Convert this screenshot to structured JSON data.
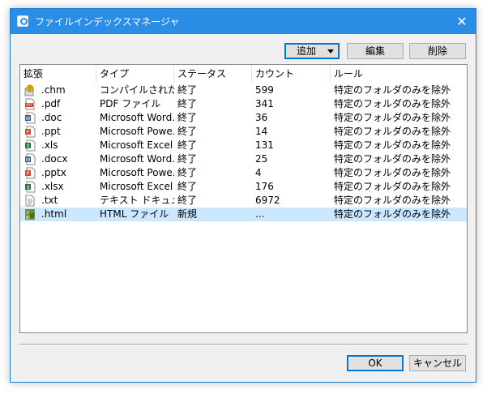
{
  "window": {
    "title": "ファイルインデックスマネージャ",
    "close_glyph": "✕"
  },
  "toolbar": {
    "add_label": "追加",
    "edit_label": "編集",
    "delete_label": "削除"
  },
  "columns": [
    "拡張",
    "タイプ",
    "ステータス",
    "カウント",
    "ルール"
  ],
  "rows": [
    {
      "ext": ".chm",
      "type": "コンパイルされた H...",
      "status": "終了",
      "count": "599",
      "rule": "特定のフォルダのみを除外",
      "icon": "chm-help-icon"
    },
    {
      "ext": ".pdf",
      "type": "PDF ファイル",
      "status": "終了",
      "count": "341",
      "rule": "特定のフォルダのみを除外",
      "icon": "pdf-file-icon"
    },
    {
      "ext": ".doc",
      "type": "Microsoft Word...",
      "status": "終了",
      "count": "36",
      "rule": "特定のフォルダのみを除外",
      "icon": "word-doc-icon"
    },
    {
      "ext": ".ppt",
      "type": "Microsoft Powe...",
      "status": "終了",
      "count": "14",
      "rule": "特定のフォルダのみを除外",
      "icon": "powerpoint-icon"
    },
    {
      "ext": ".xls",
      "type": "Microsoft Excel ...",
      "status": "終了",
      "count": "131",
      "rule": "特定のフォルダのみを除外",
      "icon": "excel-icon"
    },
    {
      "ext": ".docx",
      "type": "Microsoft Word...",
      "status": "終了",
      "count": "25",
      "rule": "特定のフォルダのみを除外",
      "icon": "word-doc-icon"
    },
    {
      "ext": ".pptx",
      "type": "Microsoft Powe...",
      "status": "終了",
      "count": "4",
      "rule": "特定のフォルダのみを除外",
      "icon": "powerpoint-icon"
    },
    {
      "ext": ".xlsx",
      "type": "Microsoft Excel ...",
      "status": "終了",
      "count": "176",
      "rule": "特定のフォルダのみを除外",
      "icon": "excel-icon"
    },
    {
      "ext": ".txt",
      "type": "テキスト ドキュメント",
      "status": "終了",
      "count": "6972",
      "rule": "特定のフォルダのみを除外",
      "icon": "text-file-icon"
    },
    {
      "ext": ".html",
      "type": "HTML ファイル",
      "status": "新規",
      "count": "...",
      "rule": "特定のフォルダのみを除外",
      "icon": "html-file-icon",
      "selected": true
    }
  ],
  "footer": {
    "ok_label": "OK",
    "cancel_label": "キャンセル"
  },
  "colors": {
    "titlebar": "#2b8ee6",
    "selection": "#cce8ff",
    "dialog_bg": "#f0f0f0"
  }
}
